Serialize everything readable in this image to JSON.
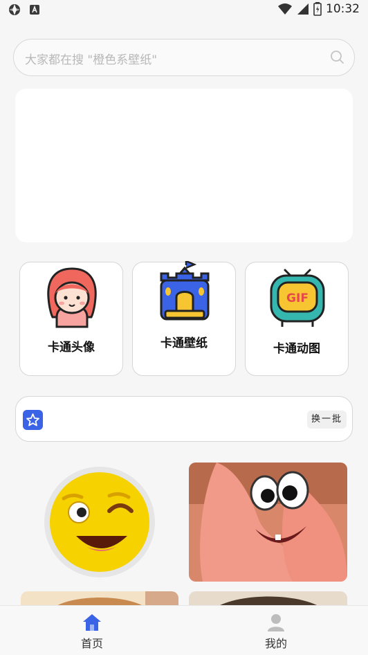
{
  "status_bar": {
    "time": "10:32"
  },
  "search": {
    "placeholder": "大家都在搜 \"橙色系壁纸\""
  },
  "categories": [
    {
      "label": "卡通头像",
      "icon": "cartoon-girl-icon"
    },
    {
      "label": "卡通壁纸",
      "icon": "castle-icon"
    },
    {
      "label": "卡通动图",
      "icon": "gif-tv-icon"
    }
  ],
  "notice": {
    "refresh_label": "换一批",
    "icon": "star-icon"
  },
  "grid_images": [
    "winking-emoji-image",
    "patrick-star-image",
    "cartoon-image",
    "portrait-image"
  ],
  "tabbar": {
    "items": [
      {
        "label": "首页",
        "icon": "home-icon",
        "active": true
      },
      {
        "label": "我的",
        "icon": "user-icon",
        "active": false
      }
    ]
  },
  "colors": {
    "accent": "#3b63e6",
    "background": "#f6f6f6"
  }
}
